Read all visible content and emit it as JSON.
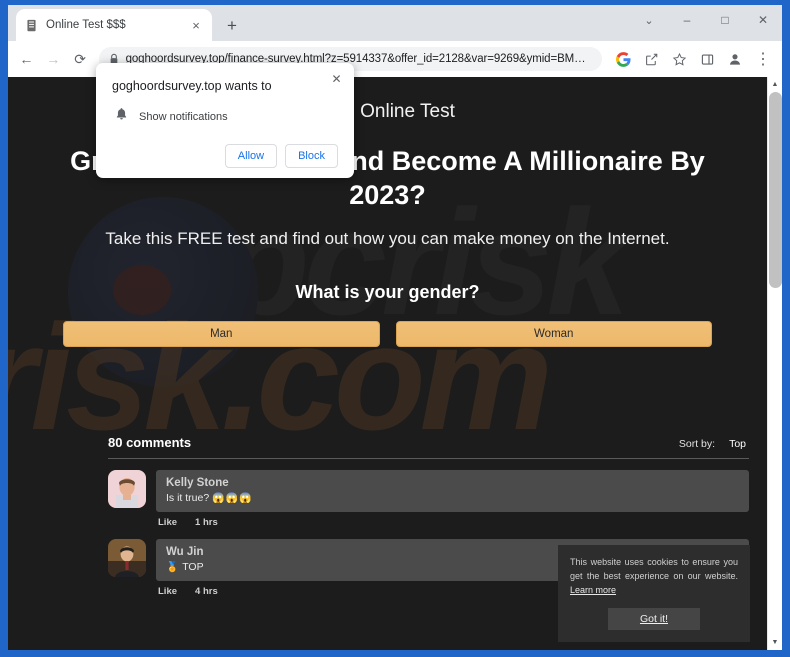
{
  "browser": {
    "tab": {
      "title": "Online Test $$$",
      "favicon_icon": "document-favicon",
      "close_icon": "×"
    },
    "new_tab_icon": "+",
    "window_controls": {
      "chevron": "⌄",
      "minimize": "–",
      "maximize": "□",
      "close": "✕"
    },
    "toolbar": {
      "back_icon": "←",
      "forward_icon": "→",
      "reload_icon": "⟳",
      "lock_icon": "lock-icon",
      "url": "goghoordsurvey.top/finance-survey.html?z=5914337&offer_id=2128&var=9269&ymid=BMRQB3...",
      "google_icon": "G",
      "share_icon": "share-icon",
      "bookmark_icon": "☆",
      "sidepanel_icon": "side-panel-icon",
      "profile_icon": "profile-icon",
      "menu_icon": "⋮"
    }
  },
  "permission_popup": {
    "title": "goghoordsurvey.top wants to",
    "option_icon": "bell-icon",
    "option_label": "Show notifications",
    "allow_label": "Allow",
    "block_label": "Block",
    "close_icon": "✕"
  },
  "page": {
    "site_title": "Online Test",
    "headline": "Great Career Online And Become A Millionaire By 2023?",
    "subline": "Take this FREE test and find out how you can make money on the Internet.",
    "question": "What is your gender?",
    "answers": [
      "Man",
      "Woman"
    ],
    "watermark_front": "risk.com",
    "watermark_back": "pcrisk",
    "comments": {
      "count_label": "80 comments",
      "sort_label": "Sort by:",
      "sort_value": "Top",
      "items": [
        {
          "name": "Kelly Stone",
          "text": "Is it true?",
          "emoji": "😱😱😱",
          "like_label": "Like",
          "time_label": "1 hrs"
        },
        {
          "name": "Wu Jin",
          "text": "TOP",
          "emoji": "🏅",
          "like_label": "Like",
          "time_label": "4 hrs"
        }
      ]
    },
    "cookie_banner": {
      "text": "This website uses cookies to ensure you get the best experience on our website.",
      "link_label": "Learn more",
      "button_label": "Got it!"
    },
    "scrollbar": {
      "up_icon": "▲",
      "down_icon": "▼"
    }
  },
  "colors": {
    "accent_button": "#eeba6c",
    "page_bg": "#1c1c1c",
    "bubble": "#4b4b4b",
    "watermark": "#4a3522"
  }
}
